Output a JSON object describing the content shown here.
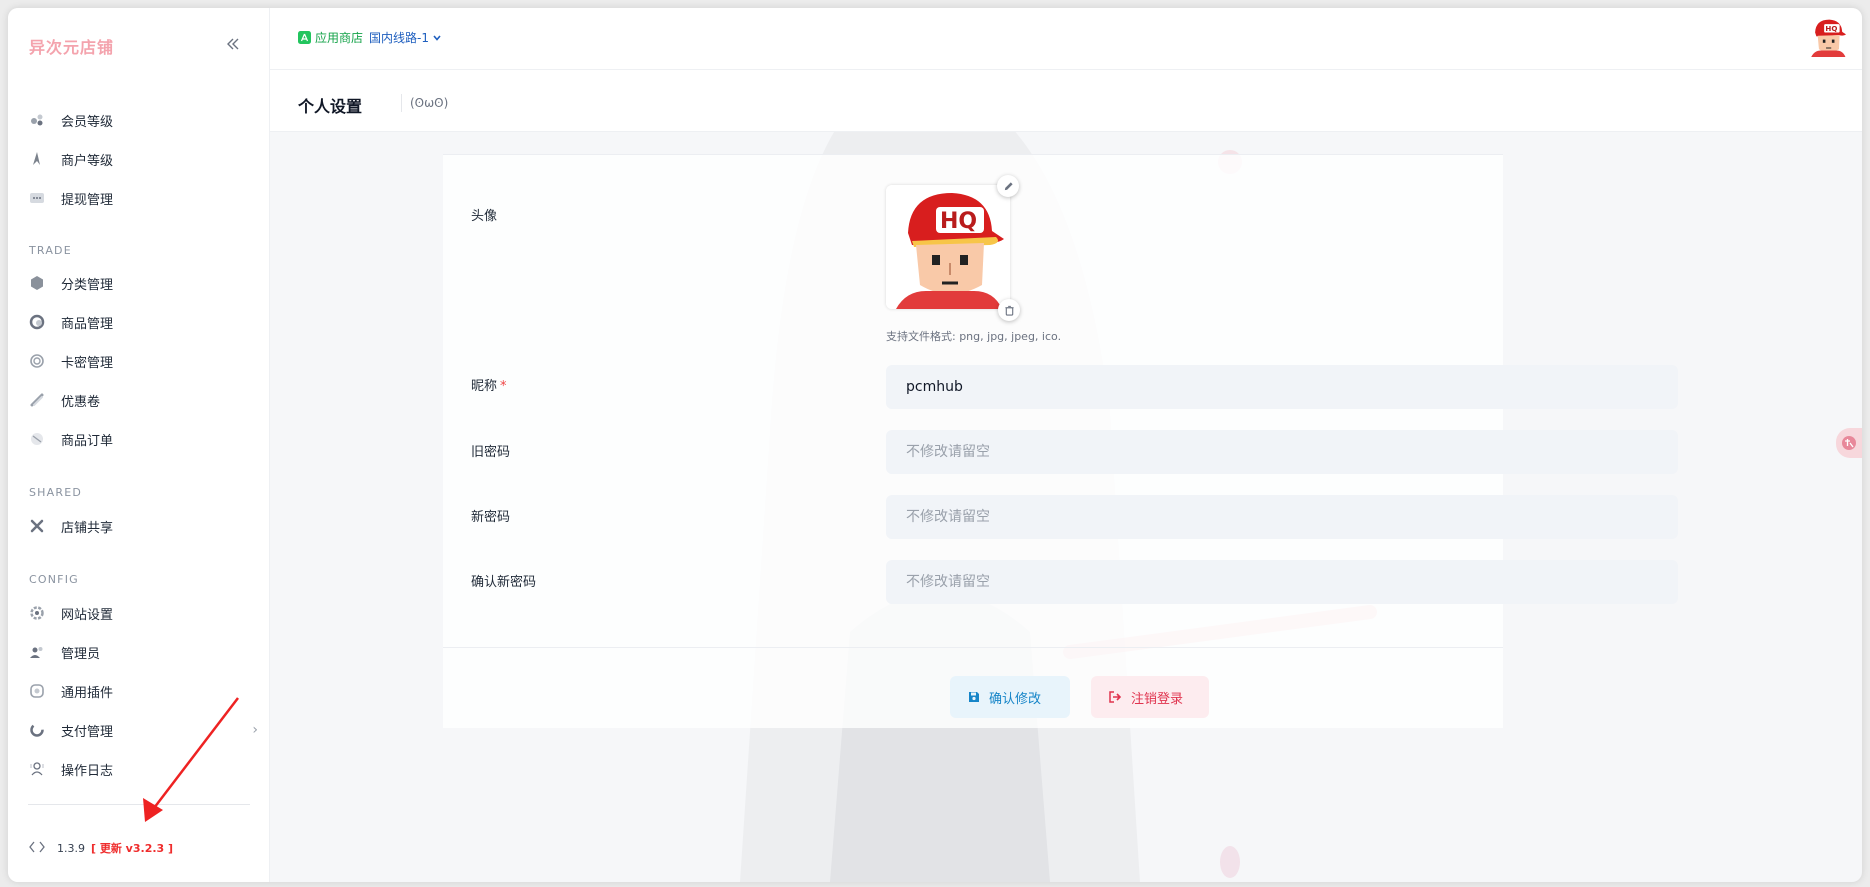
{
  "sidebar": {
    "brand": "异次元店铺",
    "items_top": [
      {
        "label": "会员等级",
        "icon": "user-level-icon"
      },
      {
        "label": "商户等级",
        "icon": "merchant-level-icon"
      },
      {
        "label": "提现管理",
        "icon": "withdraw-icon"
      }
    ],
    "section_trade": "TRADE",
    "items_trade": [
      {
        "label": "分类管理",
        "icon": "category-icon"
      },
      {
        "label": "商品管理",
        "icon": "product-icon"
      },
      {
        "label": "卡密管理",
        "icon": "card-key-icon"
      },
      {
        "label": "优惠卷",
        "icon": "coupon-icon"
      },
      {
        "label": "商品订单",
        "icon": "order-icon"
      }
    ],
    "section_shared": "SHARED",
    "items_shared": [
      {
        "label": "店铺共享",
        "icon": "share-icon"
      }
    ],
    "section_config": "CONFIG",
    "items_config": [
      {
        "label": "网站设置",
        "icon": "gear-icon"
      },
      {
        "label": "管理员",
        "icon": "admin-icon"
      },
      {
        "label": "通用插件",
        "icon": "plugin-icon"
      },
      {
        "label": "支付管理",
        "icon": "payment-icon",
        "has_arrow": true
      },
      {
        "label": "操作日志",
        "icon": "log-icon"
      }
    ],
    "version": "1.3.9",
    "update_label": "[ 更新 v3.2.3 ]"
  },
  "topbar": {
    "appstore_label": "应用商店",
    "route_label": "国内线路-1"
  },
  "page": {
    "title": "个人设置",
    "face": "(ʘωʘ)"
  },
  "form": {
    "avatar_label": "头像",
    "avatar_hint": "支持文件格式: png, jpg, jpeg, ico.",
    "nickname_label": "昵称",
    "nickname_required": "*",
    "nickname_value": "pcmhub",
    "old_password_label": "旧密码",
    "old_password_placeholder": "不修改请留空",
    "new_password_label": "新密码",
    "new_password_placeholder": "不修改请留空",
    "confirm_password_label": "确认新密码",
    "confirm_password_placeholder": "不修改请留空",
    "save_label": "确认修改",
    "logout_label": "注销登录"
  },
  "colors": {
    "brand": "#f4a3ad",
    "save_text": "#1685c8",
    "logout_text": "#e0344f",
    "update_text": "#ef2d2d",
    "appstore_green": "#16a34a"
  }
}
